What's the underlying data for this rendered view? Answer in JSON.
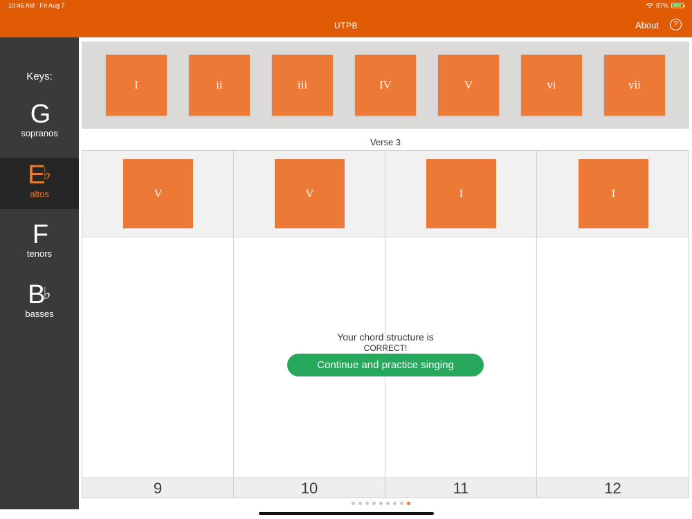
{
  "status_bar": {
    "time": "10:46 AM",
    "date": "Fri Aug 7",
    "battery": "87%",
    "battery_level": 0.87
  },
  "header": {
    "title": "UTPB",
    "about_label": "About",
    "help_glyph": "?"
  },
  "sidebar": {
    "title": "Keys:",
    "keys": [
      {
        "letter": "G",
        "accidental": "",
        "name": "sopranos",
        "active": false
      },
      {
        "letter": "E",
        "accidental": "♭",
        "name": "altos",
        "active": true
      },
      {
        "letter": "F",
        "accidental": "",
        "name": "tenors",
        "active": false
      },
      {
        "letter": "B",
        "accidental": "♭",
        "name": "basses",
        "active": false
      }
    ]
  },
  "palette": {
    "chords": [
      "I",
      "ii",
      "iii",
      "IV",
      "V",
      "vi",
      "vii"
    ]
  },
  "verse_label": "Verse 3",
  "measures": [
    {
      "number": "9",
      "chord": "V"
    },
    {
      "number": "10",
      "chord": "V"
    },
    {
      "number": "11",
      "chord": "I"
    },
    {
      "number": "12",
      "chord": "I"
    }
  ],
  "result": {
    "line1": "Your chord structure is",
    "line2": "CORRECT!",
    "button_label": "Continue and practice singing"
  },
  "pagination": {
    "total": 9,
    "current": 9
  },
  "colors": {
    "header": "#e15b05",
    "sidebar": "#3a3a3a",
    "tile": "#ec7935",
    "active_key": "#ef7f2c",
    "button": "#26a95c"
  },
  "icons": {
    "help": "question-circle-icon",
    "wifi": "wifi-icon",
    "battery": "battery-icon"
  }
}
